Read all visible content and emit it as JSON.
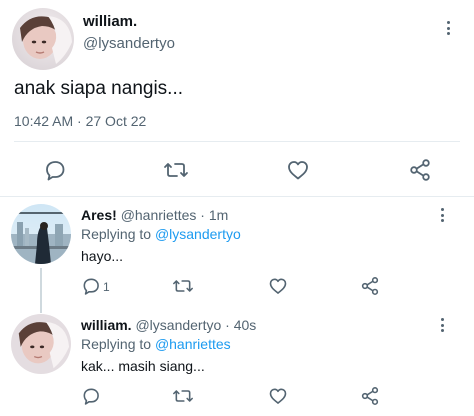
{
  "main_tweet": {
    "name": "william.",
    "handle": "@lysandertyo",
    "text": "anak siapa nangis...",
    "timestamp": "10:42 AM · 27 Oct 22",
    "actions": [
      "reply-icon",
      "retweet-icon",
      "like-icon",
      "share-icon"
    ]
  },
  "replies": [
    {
      "name": "Ares!",
      "handle": "@hanriettes",
      "separator": "·",
      "time": "1m",
      "replying_prefix": "Replying to",
      "replying_to": "@lysandertyo",
      "text": "hayo...",
      "reply_count": "1"
    },
    {
      "name": "william.",
      "handle": "@lysandertyo",
      "separator": "·",
      "time": "40s",
      "replying_prefix": "Replying to",
      "replying_to": "@hanriettes",
      "text": "kak... masih siang...",
      "reply_count": ""
    }
  ],
  "colors": {
    "link": "#1d9bf0",
    "secondary_text": "#536471",
    "divider": "#e6ecf0",
    "thread_line": "#cfd9de"
  }
}
